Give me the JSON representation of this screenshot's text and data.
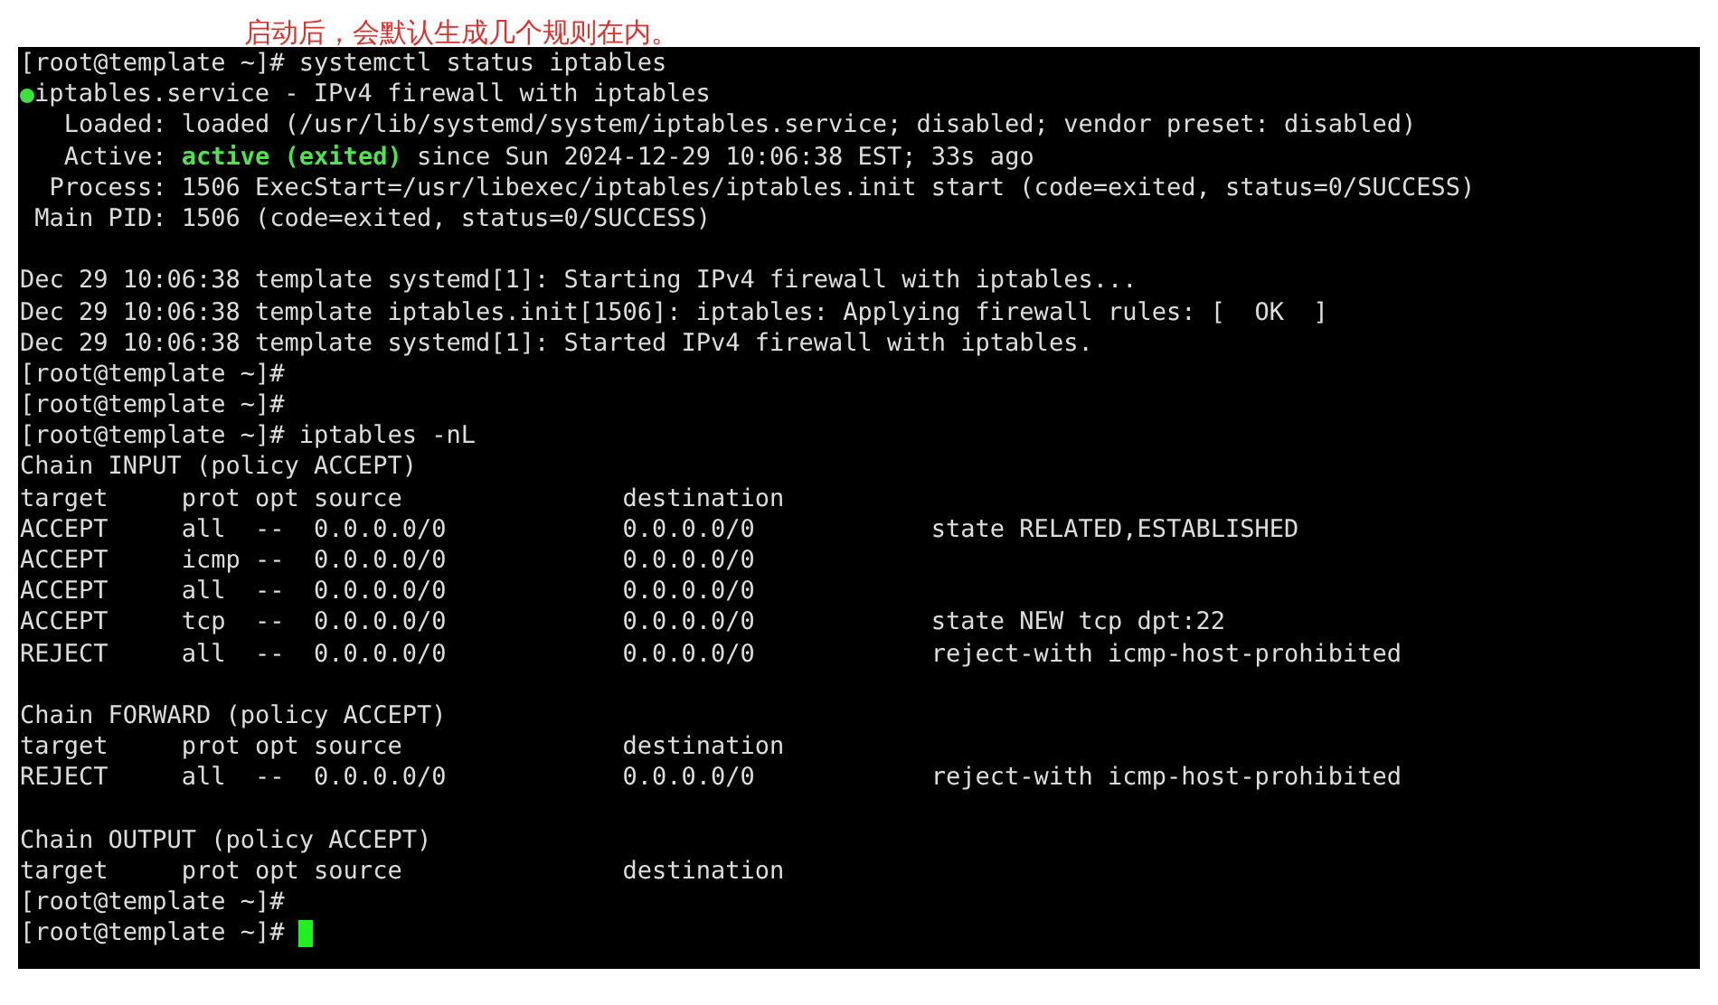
{
  "caption": "启动后，会默认生成几个规则在内。",
  "terminal": {
    "lines": [
      {
        "kind": "text",
        "text": "[root@template ~]# systemctl status iptables"
      },
      {
        "kind": "unit",
        "text": "iptables.service - IPv4 firewall with iptables"
      },
      {
        "kind": "text",
        "text": "   Loaded: loaded (/usr/lib/systemd/system/iptables.service; disabled; vendor preset: disabled)"
      },
      {
        "kind": "status",
        "label": "   Active: ",
        "value": "active (exited)",
        "rest": " since Sun 2024-12-29 10:06:38 EST; 33s ago"
      },
      {
        "kind": "text",
        "text": "  Process: 1506 ExecStart=/usr/libexec/iptables/iptables.init start (code=exited, status=0/SUCCESS)"
      },
      {
        "kind": "text",
        "text": " Main PID: 1506 (code=exited, status=0/SUCCESS)"
      },
      {
        "kind": "blank"
      },
      {
        "kind": "text",
        "text": "Dec 29 10:06:38 template systemd[1]: Starting IPv4 firewall with iptables..."
      },
      {
        "kind": "text",
        "text": "Dec 29 10:06:38 template iptables.init[1506]: iptables: Applying firewall rules: [  OK  ]"
      },
      {
        "kind": "text",
        "text": "Dec 29 10:06:38 template systemd[1]: Started IPv4 firewall with iptables."
      },
      {
        "kind": "text",
        "text": "[root@template ~]#"
      },
      {
        "kind": "text",
        "text": "[root@template ~]#"
      },
      {
        "kind": "text",
        "text": "[root@template ~]# iptables -nL"
      },
      {
        "kind": "text",
        "text": "Chain INPUT (policy ACCEPT)"
      },
      {
        "kind": "text",
        "text": "target     prot opt source               destination"
      },
      {
        "kind": "text",
        "text": "ACCEPT     all  --  0.0.0.0/0            0.0.0.0/0            state RELATED,ESTABLISHED"
      },
      {
        "kind": "text",
        "text": "ACCEPT     icmp --  0.0.0.0/0            0.0.0.0/0"
      },
      {
        "kind": "text",
        "text": "ACCEPT     all  --  0.0.0.0/0            0.0.0.0/0"
      },
      {
        "kind": "text",
        "text": "ACCEPT     tcp  --  0.0.0.0/0            0.0.0.0/0            state NEW tcp dpt:22"
      },
      {
        "kind": "text",
        "text": "REJECT     all  --  0.0.0.0/0            0.0.0.0/0            reject-with icmp-host-prohibited"
      },
      {
        "kind": "blank"
      },
      {
        "kind": "text",
        "text": "Chain FORWARD (policy ACCEPT)"
      },
      {
        "kind": "text",
        "text": "target     prot opt source               destination"
      },
      {
        "kind": "text",
        "text": "REJECT     all  --  0.0.0.0/0            0.0.0.0/0            reject-with icmp-host-prohibited"
      },
      {
        "kind": "blank"
      },
      {
        "kind": "text",
        "text": "Chain OUTPUT (policy ACCEPT)"
      },
      {
        "kind": "text",
        "text": "target     prot opt source               destination"
      },
      {
        "kind": "text",
        "text": "[root@template ~]#"
      },
      {
        "kind": "prompt",
        "text": "[root@template ~]# "
      }
    ]
  }
}
